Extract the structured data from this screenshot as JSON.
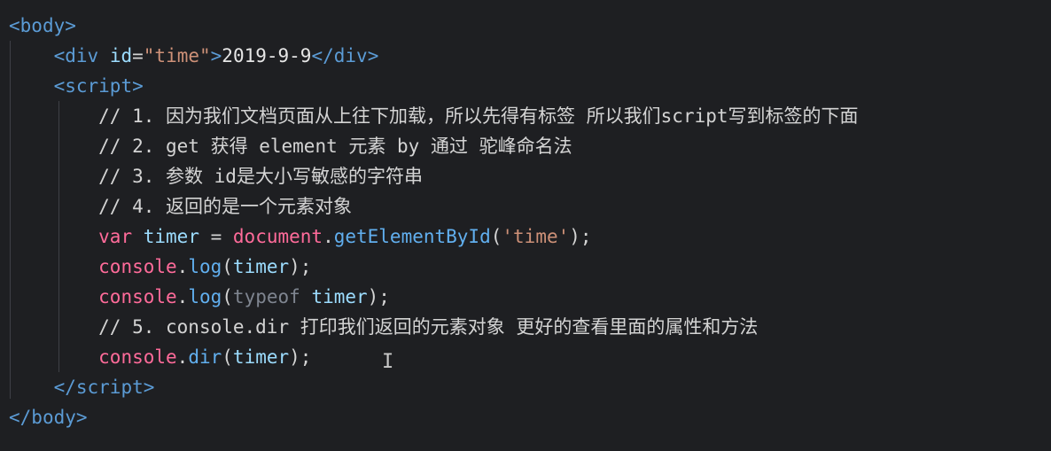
{
  "lines": {
    "l0": {
      "open": "<",
      "tag": "body",
      "close": ">"
    },
    "l1": {
      "open": "<",
      "tag": "div",
      "attr": "id",
      "eq": "=",
      "val": "\"time\"",
      "gt": ">",
      "text": "2019-9-9",
      "endopen": "</",
      "endtag": "div",
      "endclose": ">"
    },
    "l2": {
      "open": "<",
      "tag": "script",
      "close": ">"
    },
    "l3": {
      "comment": "// 1. 因为我们文档页面从上往下加载，所以先得有标签 所以我们script写到标签的下面"
    },
    "l4": {
      "comment": "// 2. get 获得 element 元素 by 通过 驼峰命名法"
    },
    "l5": {
      "comment": "// 3. 参数 id是大小写敏感的字符串"
    },
    "l6": {
      "comment": "// 4. 返回的是一个元素对象"
    },
    "l7": {
      "kw": "var",
      "sp1": " ",
      "name": "timer",
      "eq": " = ",
      "obj": "document",
      "dot": ".",
      "fn": "getElementById",
      "lp": "(",
      "arg": "'time'",
      "rp": ");"
    },
    "l8": {
      "obj": "console",
      "dot": ".",
      "fn": "log",
      "lp": "(",
      "arg": "timer",
      "rp": ");"
    },
    "l9": {
      "obj": "console",
      "dot": ".",
      "fn": "log",
      "lp": "(",
      "kw": "typeof",
      "sp": " ",
      "arg": "timer",
      "rp": ");"
    },
    "l10": {
      "comment": "// 5. console.dir 打印我们返回的元素对象 更好的查看里面的属性和方法"
    },
    "l11": {
      "obj": "console",
      "dot": ".",
      "fn": "dir",
      "lp": "(",
      "arg": "timer",
      "rp": ");"
    },
    "l12": {
      "open": "</",
      "tag": "script",
      "close": ">"
    },
    "l13": {
      "open": "</",
      "tag": "body",
      "close": ">"
    }
  },
  "cursor_glyph": "I"
}
